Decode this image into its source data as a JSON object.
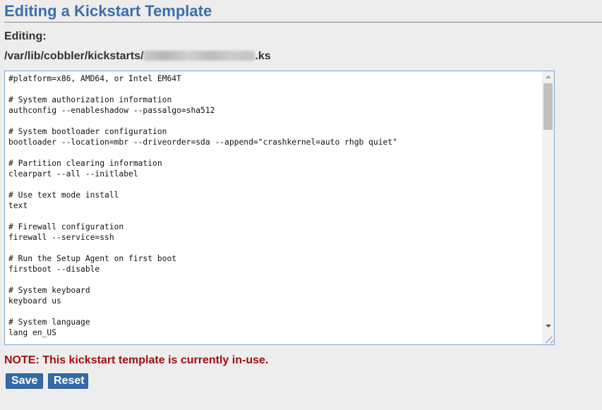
{
  "header": {
    "title": "Editing a Kickstart Template"
  },
  "editing_label": "Editing:",
  "file_path": {
    "prefix": "/var/lib/cobbler/kickstarts/",
    "suffix": ".ks"
  },
  "editor": {
    "content": "#platform=x86, AMD64, or Intel EM64T\n\n# System authorization information\nauthconfig --enableshadow --passalgo=sha512\n\n# System bootloader configuration\nbootloader --location=mbr --driveorder=sda --append=\"crashkernel=auto rhgb quiet\"\n\n# Partition clearing information\nclearpart --all --initlabel\n\n# Use text mode install\ntext\n\n# Firewall configuration\nfirewall --service=ssh\n\n# Run the Setup Agent on first boot\nfirstboot --disable\n\n# System keyboard\nkeyboard us\n\n# System language\nlang en_US"
  },
  "note": "NOTE: This kickstart template is currently in-use.",
  "buttons": {
    "save": "Save",
    "reset": "Reset"
  },
  "colors": {
    "title": "#3a6fb0",
    "note": "#a00f0f",
    "button": "#336aa8",
    "background": "#ededed"
  }
}
